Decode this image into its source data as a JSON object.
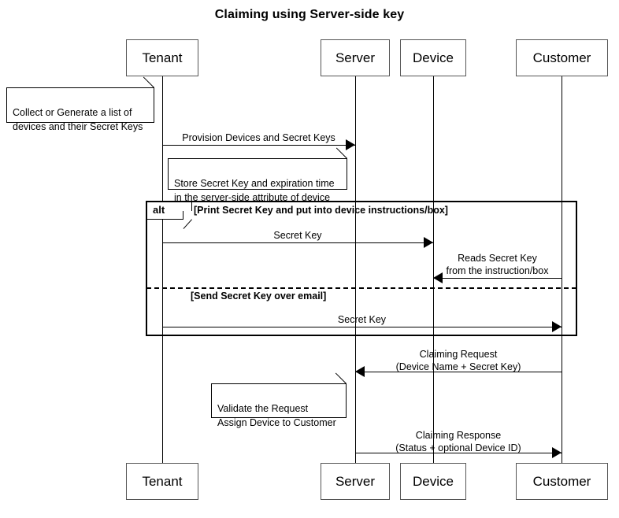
{
  "diagram": {
    "title": "Claiming using Server-side key",
    "type": "uml-sequence-diagram"
  },
  "lifelines": [
    {
      "id": "tenant",
      "label": "Tenant"
    },
    {
      "id": "server",
      "label": "Server"
    },
    {
      "id": "device",
      "label": "Device"
    },
    {
      "id": "customer",
      "label": "Customer"
    }
  ],
  "notes": [
    {
      "id": "note-collect",
      "text": "Collect or Generate a list of\ndevices and their Secret Keys",
      "attached_to": "tenant"
    },
    {
      "id": "note-store",
      "text": "Store Secret Key and expiration time\nin the server-side attribute of device",
      "attached_to": "server"
    },
    {
      "id": "note-validate",
      "text": "Validate the Request\nAssign Device to Customer",
      "attached_to": "server"
    }
  ],
  "messages": [
    {
      "id": "msg-provision",
      "label": "Provision Devices and Secret Keys",
      "from": "tenant",
      "to": "server",
      "direction": "right"
    },
    {
      "id": "msg-secret-key-device",
      "label": "Secret Key",
      "from": "tenant",
      "to": "device",
      "direction": "right"
    },
    {
      "id": "msg-reads-secret-key",
      "label": "Reads Secret Key\nfrom the instruction/box",
      "from": "customer",
      "to": "device",
      "direction": "left"
    },
    {
      "id": "msg-secret-key-customer",
      "label": "Secret Key",
      "from": "tenant",
      "to": "customer",
      "direction": "right"
    },
    {
      "id": "msg-claiming-request",
      "label": "Claiming Request\n(Device Name + Secret Key)",
      "from": "customer",
      "to": "server",
      "direction": "left"
    },
    {
      "id": "msg-claiming-response",
      "label": "Claiming Response\n(Status + optional Device ID)",
      "from": "server",
      "to": "customer",
      "direction": "right"
    }
  ],
  "fragment": {
    "operator": "alt",
    "guards": [
      "[Print Secret Key and put into device instructions/box]",
      "[Send Secret Key over email]"
    ]
  },
  "colors": {
    "stroke": "#000000",
    "actor_border": "#555555",
    "background": "#ffffff"
  }
}
